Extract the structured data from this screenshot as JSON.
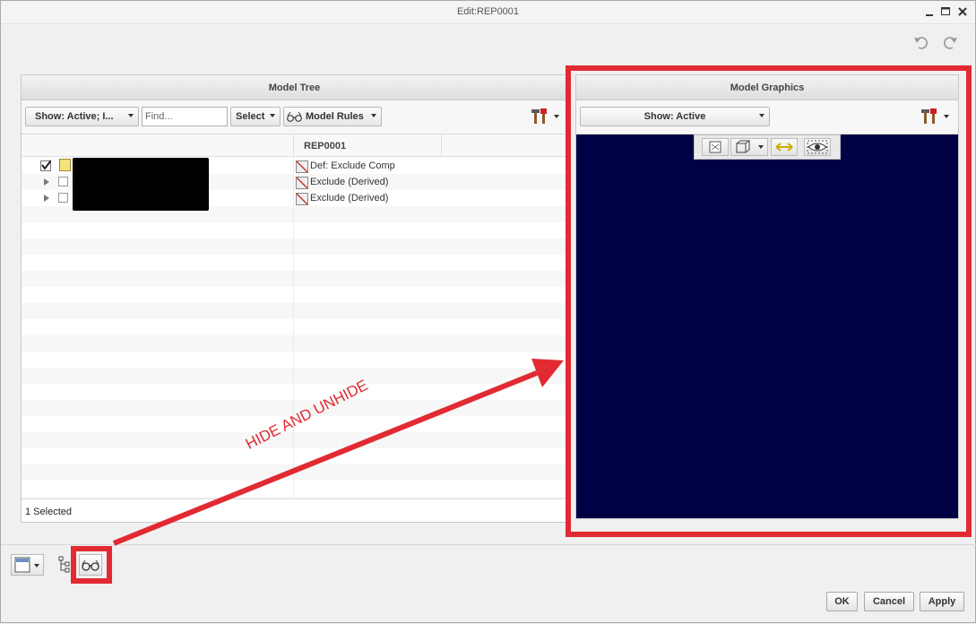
{
  "window": {
    "title": "Edit:REP0001"
  },
  "model_tree": {
    "header": "Model Tree",
    "show_dropdown": "Show: Active; I...",
    "find_placeholder": "Find...",
    "select_label": "Select",
    "model_rules_label": "Model Rules",
    "column_header": "REP0001",
    "rows": [
      {
        "rule": "Def: Exclude Comp",
        "checked": true
      },
      {
        "rule": "Exclude (Derived)",
        "checked": false
      },
      {
        "rule": "Exclude (Derived)",
        "checked": false
      }
    ],
    "status": "1 Selected"
  },
  "model_graphics": {
    "header": "Model Graphics",
    "show_dropdown": "Show: Active",
    "background_color": "#000044"
  },
  "annotation": {
    "text": "HIDE AND UNHIDE",
    "color": "#e12a32"
  },
  "footer": {
    "ok": "OK",
    "cancel": "Cancel",
    "apply": "Apply"
  }
}
